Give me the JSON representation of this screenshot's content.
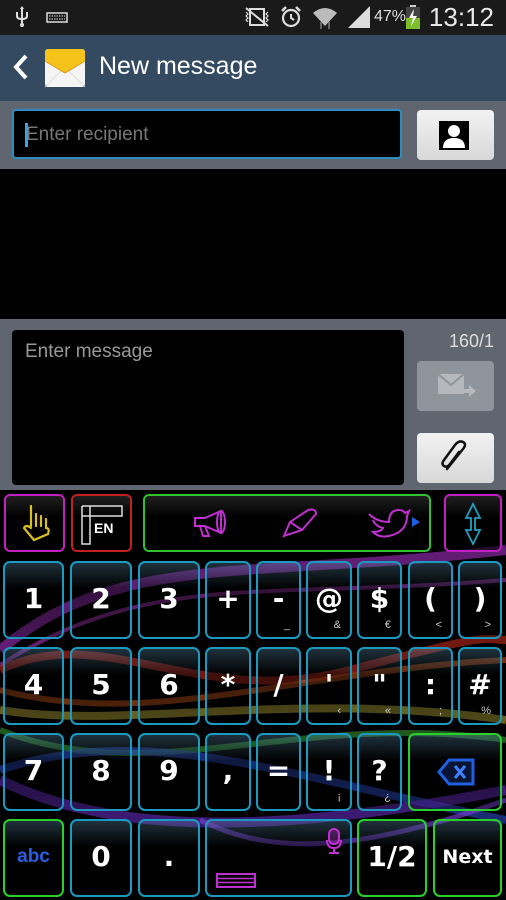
{
  "status_bar": {
    "left_icons": [
      "usb-icon",
      "keyboard-icon"
    ],
    "right_icons": [
      "mute-vibrate-icon",
      "alarm-icon",
      "wifi-icon",
      "signal-icon"
    ],
    "battery_percent": "47%",
    "time": "13:12"
  },
  "action_bar": {
    "title": "New message"
  },
  "recipient": {
    "placeholder": "Enter recipient",
    "value": ""
  },
  "compose": {
    "placeholder": "Enter message",
    "value": "",
    "counter": "160/1"
  },
  "keyboard": {
    "toolbar": {
      "language": "EN",
      "shortcut_icons": [
        "megaphone-icon",
        "pen-icon",
        "twitter-bird-icon"
      ]
    },
    "rows": [
      [
        {
          "main": "1",
          "sub": ""
        },
        {
          "main": "2",
          "sub": ""
        },
        {
          "main": "3",
          "sub": ""
        },
        {
          "main": "+",
          "sub": ""
        },
        {
          "main": "-",
          "sub": "_"
        },
        {
          "main": "@",
          "sub": "&"
        },
        {
          "main": "$",
          "sub": "€"
        },
        {
          "main": "(",
          "sub": "<"
        },
        {
          "main": ")",
          "sub": ">"
        }
      ],
      [
        {
          "main": "4",
          "sub": ""
        },
        {
          "main": "5",
          "sub": ""
        },
        {
          "main": "6",
          "sub": ""
        },
        {
          "main": "*",
          "sub": ""
        },
        {
          "main": "/",
          "sub": ""
        },
        {
          "main": "'",
          "sub": "‹"
        },
        {
          "main": "\"",
          "sub": "«"
        },
        {
          "main": ":",
          "sub": ";"
        },
        {
          "main": "#",
          "sub": "%"
        }
      ],
      [
        {
          "main": "7",
          "sub": ""
        },
        {
          "main": "8",
          "sub": ""
        },
        {
          "main": "9",
          "sub": ""
        },
        {
          "main": ",",
          "sub": ""
        },
        {
          "main": "=",
          "sub": ""
        },
        {
          "main": "!",
          "sub": "¡"
        },
        {
          "main": "?",
          "sub": "¿"
        }
      ]
    ],
    "bottom_row": {
      "abc": "abc",
      "zero": "0",
      "period": ".",
      "page": "1/2",
      "next": "Next"
    }
  }
}
